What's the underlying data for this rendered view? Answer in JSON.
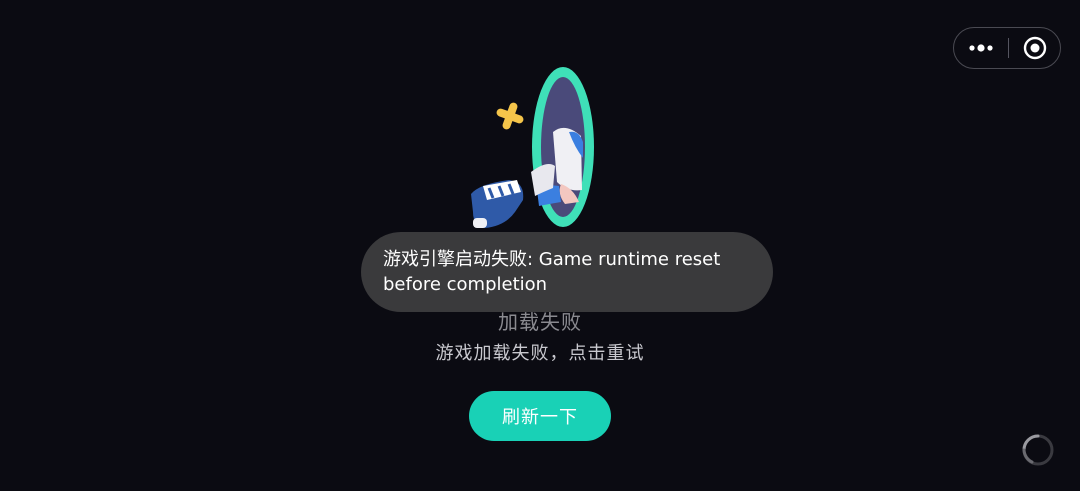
{
  "menu": {
    "more_icon": "more-dots-icon",
    "close_icon": "target-close-icon"
  },
  "illustration": {
    "name": "portal-character-illustration",
    "colors": {
      "portal": "#3fe0b8",
      "portal_inner": "#4a4a7a",
      "star": "#f5c54a",
      "sleeve": "#3b7fe0",
      "shoe": "#2f5aa8"
    }
  },
  "error": {
    "title": "加载失败",
    "subtitle": "游戏加载失败，点击重试"
  },
  "refresh_button": {
    "label": "刷新一下",
    "color": "#19d1b6"
  },
  "toast": {
    "message": "游戏引擎启动失败: Game runtime reset before completion"
  },
  "loading": {
    "icon": "loading-spinner-icon"
  }
}
